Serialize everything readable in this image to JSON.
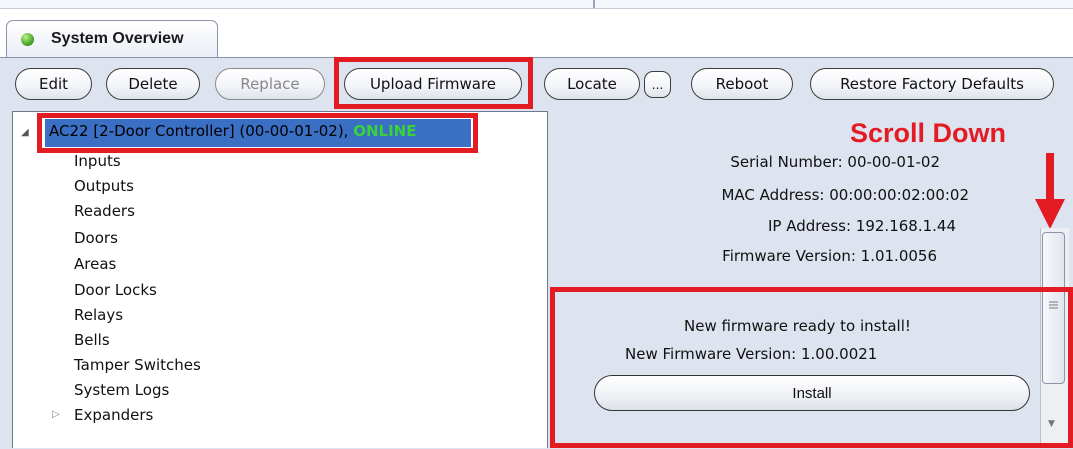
{
  "tab": {
    "title": "System Overview"
  },
  "toolbar": {
    "edit": "Edit",
    "delete": "Delete",
    "replace": "Replace",
    "upload_firmware": "Upload Firmware",
    "locate": "Locate",
    "more": "...",
    "reboot": "Reboot",
    "restore": "Restore Factory Defaults"
  },
  "tree": {
    "root_label": "AC22 [2-Door Controller] (00-00-01-02),",
    "root_status": "ONLINE",
    "items": [
      "Inputs",
      "Outputs",
      "Readers",
      "Doors",
      "Areas",
      "Door Locks",
      "Relays",
      "Bells",
      "Tamper Switches",
      "System Logs",
      "Expanders"
    ]
  },
  "details": {
    "serial": "Serial Number: 00-00-01-02",
    "mac": "MAC Address: 00:00:00:02:00:02",
    "ip": "IP Address: 192.168.1.44",
    "firmware": "Firmware Version: 1.01.0056"
  },
  "annotation": {
    "scroll_down": "Scroll Down"
  },
  "new_firmware": {
    "message": "New firmware ready to install!",
    "version": "New Firmware Version: 1.00.0021",
    "install_label": "Install"
  },
  "colors": {
    "highlight": "#e31b23",
    "selection": "#3a6fc4",
    "online": "#38d338"
  }
}
